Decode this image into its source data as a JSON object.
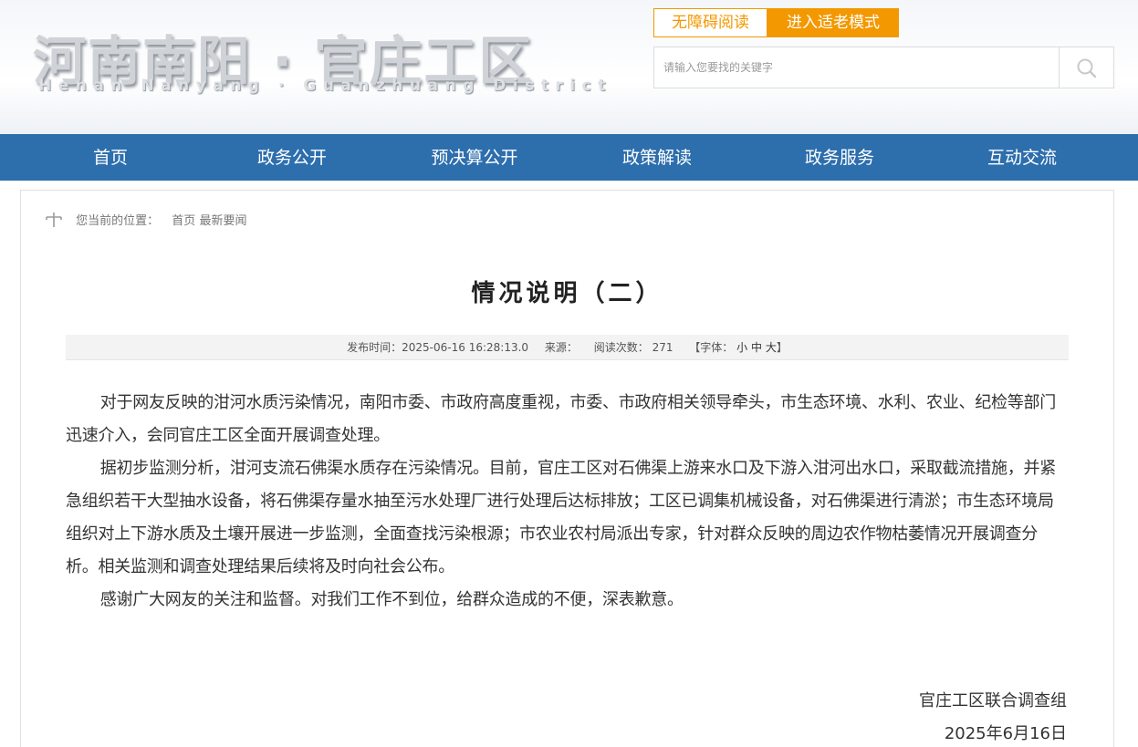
{
  "header": {
    "logo_cn": "河南南阳 · 官庄工区",
    "logo_en": "Henan Nanyang · Guanzhuang District",
    "accessibility_label": "无障碍阅读",
    "elder_mode_label": "进入适老模式",
    "search_placeholder": "请输入您要找的关键字",
    "search_icon": "search-icon"
  },
  "colors": {
    "nav_bg": "#2d6ead",
    "accent_orange": "#f39800"
  },
  "nav": {
    "items": [
      {
        "label": "首页"
      },
      {
        "label": "政务公开"
      },
      {
        "label": "预决算公开"
      },
      {
        "label": "政策解读"
      },
      {
        "label": "政务服务"
      },
      {
        "label": "互动交流"
      }
    ]
  },
  "breadcrumb": {
    "prefix": "您当前的位置：",
    "home": "首页",
    "current": "最新要闻",
    "icon": "location-pin-icon"
  },
  "article": {
    "title": "情况说明（二）",
    "meta": {
      "publish_label": "发布时间：",
      "publish_time": "2025-06-16 16:28:13.0",
      "source_label": "来源：",
      "views_label": "阅读次数：",
      "views_count": "271",
      "font_label": "【字体：",
      "font_small": "小",
      "font_medium": "中",
      "font_large": "大",
      "font_close": "】"
    },
    "paragraphs": [
      "对于网友反映的泔河水质污染情况，南阳市委、市政府高度重视，市委、市政府相关领导牵头，市生态环境、水利、农业、纪检等部门迅速介入，会同官庄工区全面开展调查处理。",
      "据初步监测分析，泔河支流石佛渠水质存在污染情况。目前，官庄工区对石佛渠上游来水口及下游入泔河出水口，采取截流措施，并紧急组织若干大型抽水设备，将石佛渠存量水抽至污水处理厂进行处理后达标排放；工区已调集机械设备，对石佛渠进行清淤；市生态环境局组织对上下游水质及土壤开展进一步监测，全面查找污染根源；市农业农村局派出专家，针对群众反映的周边农作物枯萎情况开展调查分析。相关监测和调查处理结果后续将及时向社会公布。",
      "感谢广大网友的关注和监督。对我们工作不到位，给群众造成的不便，深表歉意。"
    ],
    "signature": "官庄工区联合调查组",
    "date": "2025年6月16日"
  }
}
